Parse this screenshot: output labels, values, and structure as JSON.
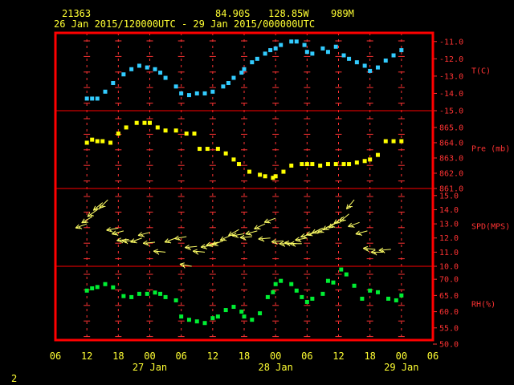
{
  "header": {
    "station_id": "21363",
    "lat": "84.90S",
    "lon": "128.85W",
    "elev": "989M",
    "period": "26 Jan 2015/120000UTC - 29 Jan 2015/000000UTC"
  },
  "footer": {
    "page": "2"
  },
  "colors": {
    "frame": "#ff0000",
    "grid": "#ff3333",
    "text": "#ffff33",
    "temp": "#33ccff",
    "pres": "#ffff00",
    "wind": "#ffff66",
    "rh": "#00ee33"
  },
  "x_axis": {
    "ticks": [
      {
        "h": 0,
        "label": "06"
      },
      {
        "h": 6,
        "label": "12"
      },
      {
        "h": 12,
        "label": "18"
      },
      {
        "h": 18,
        "label": "00"
      },
      {
        "h": 24,
        "label": "06"
      },
      {
        "h": 30,
        "label": "12"
      },
      {
        "h": 36,
        "label": "18"
      },
      {
        "h": 42,
        "label": "00"
      },
      {
        "h": 48,
        "label": "06"
      },
      {
        "h": 54,
        "label": "12"
      },
      {
        "h": 60,
        "label": "18"
      },
      {
        "h": 66,
        "label": "00"
      },
      {
        "h": 72,
        "label": "06"
      }
    ],
    "dates": [
      {
        "h": 18,
        "label": "27 Jan"
      },
      {
        "h": 42,
        "label": "28 Jan"
      },
      {
        "h": 66,
        "label": "29 Jan"
      }
    ],
    "range": [
      0,
      72
    ],
    "origin": "26 Jan 2015 06UTC"
  },
  "chart_data": [
    {
      "type": "scatter",
      "name_label": "T(C)",
      "ylim": [
        -15,
        -10.5
      ],
      "yticks": [
        "-11.0",
        "-12.0",
        "-13.0",
        "-14.0",
        "-15.0"
      ],
      "ytick_values": [
        -11,
        -12,
        -13,
        -14,
        -15
      ],
      "x": [
        6,
        7,
        8,
        9.5,
        11,
        13,
        14.5,
        16,
        17.5,
        19,
        20,
        21,
        23,
        24,
        25.5,
        27,
        28.5,
        30,
        32,
        33,
        34,
        35.5,
        36,
        37.5,
        38.5,
        40,
        41,
        42,
        43,
        45,
        46,
        47.5,
        48,
        49,
        51,
        52,
        53.5,
        55,
        56,
        57.5,
        59,
        60,
        61.5,
        63,
        64.5,
        66
      ],
      "y": [
        -14.3,
        -14.3,
        -14.3,
        -13.9,
        -13.4,
        -12.9,
        -12.6,
        -12.4,
        -12.5,
        -12.6,
        -12.8,
        -13.1,
        -13.6,
        -14.0,
        -14.1,
        -14.0,
        -14.0,
        -13.9,
        -13.6,
        -13.4,
        -13.1,
        -12.8,
        -12.6,
        -12.2,
        -12.0,
        -11.7,
        -11.5,
        -11.4,
        -11.2,
        -11.0,
        -11.0,
        -11.2,
        -11.6,
        -11.7,
        -11.4,
        -11.6,
        -11.3,
        -11.8,
        -12.0,
        -12.2,
        -12.4,
        -12.7,
        -12.5,
        -12.1,
        -11.8,
        -11.5
      ]
    },
    {
      "type": "scatter",
      "name_label": "Pre (mb)",
      "ylim": [
        861,
        866.1
      ],
      "yticks": [
        "865.0",
        "864.0",
        "863.0",
        "862.0",
        "861.0"
      ],
      "ytick_values": [
        865,
        864,
        863,
        862,
        861
      ],
      "x": [
        6,
        7,
        8,
        9,
        10.5,
        12,
        13.5,
        15.5,
        17,
        18,
        19.5,
        21,
        23,
        25,
        26.5,
        27.5,
        29,
        31,
        32.5,
        34,
        35,
        37,
        39,
        40,
        41.5,
        42,
        43.5,
        45,
        47,
        48,
        49,
        50.5,
        52,
        53.5,
        55,
        56,
        57.5,
        59,
        60,
        61.5,
        63,
        64.5,
        66
      ],
      "y": [
        864.0,
        864.2,
        864.1,
        864.1,
        864.0,
        864.6,
        865.0,
        865.3,
        865.3,
        865.3,
        865.0,
        864.8,
        864.8,
        864.6,
        864.6,
        863.6,
        863.6,
        863.6,
        863.3,
        862.9,
        862.6,
        862.1,
        861.9,
        861.8,
        861.7,
        861.8,
        862.1,
        862.5,
        862.6,
        862.6,
        862.6,
        862.5,
        862.6,
        862.6,
        862.6,
        862.6,
        862.7,
        862.8,
        862.9,
        863.2,
        864.1,
        864.1,
        864.1
      ]
    },
    {
      "type": "vector",
      "name_label": "SPD(MPS)",
      "ylim": [
        10,
        15.5
      ],
      "yticks": [
        "15.0",
        "14.0",
        "13.0",
        "12.0",
        "11.0",
        "10.0"
      ],
      "ytick_values": [
        15,
        14,
        13,
        12,
        11,
        10
      ],
      "x": [
        6,
        7,
        8,
        9,
        10,
        12,
        13,
        14,
        15,
        16.5,
        18,
        19,
        21,
        23,
        25,
        26,
        27,
        28.5,
        30,
        31,
        32,
        33.5,
        35,
        36,
        37.5,
        38.5,
        40,
        41,
        42,
        43.5,
        45,
        46,
        47,
        48,
        49,
        50,
        51,
        52,
        53,
        54,
        55,
        56,
        57,
        58,
        59.5,
        61,
        62.5,
        64
      ],
      "y": [
        13.0,
        13.5,
        14.0,
        14.5,
        14.7,
        12.7,
        12.5,
        11.9,
        11.8,
        12.0,
        12.4,
        11.7,
        11.0,
        12.0,
        12.1,
        10.0,
        11.4,
        11.0,
        11.5,
        11.7,
        11.8,
        12.2,
        12.6,
        12.3,
        12.1,
        12.5,
        13.0,
        12.0,
        13.4,
        11.8,
        11.6,
        11.6,
        11.6,
        12.0,
        12.3,
        12.5,
        12.7,
        12.8,
        13.0,
        13.2,
        13.5,
        13.7,
        14.7,
        13.1,
        12.5,
        11.2,
        11.0,
        11.2
      ],
      "dir_deg": [
        200,
        210,
        215,
        220,
        225,
        190,
        195,
        185,
        180,
        200,
        195,
        185,
        175,
        200,
        190,
        170,
        185,
        175,
        190,
        195,
        200,
        205,
        210,
        190,
        185,
        195,
        205,
        185,
        200,
        185,
        180,
        175,
        180,
        190,
        195,
        200,
        205,
        210,
        210,
        215,
        215,
        220,
        230,
        200,
        195,
        175,
        180,
        185
      ]
    },
    {
      "type": "scatter",
      "name_label": "RH(%)",
      "ylim": [
        50,
        74
      ],
      "yticks": [
        "70.0",
        "65.0",
        "60.0",
        "55.0",
        "50.0"
      ],
      "ytick_values": [
        70,
        65,
        60,
        55,
        50
      ],
      "x": [
        6,
        7,
        8,
        9.5,
        11,
        13,
        14.5,
        16,
        17.5,
        19,
        20,
        21,
        23,
        24,
        25.5,
        27,
        28.5,
        30,
        31,
        32.5,
        34,
        35.5,
        36,
        37.5,
        39,
        40.5,
        41.5,
        42,
        43,
        45,
        46,
        47,
        48,
        49,
        51,
        52,
        53,
        54.5,
        55.5,
        57,
        58.5,
        60,
        61.5,
        63.5,
        65,
        66
      ],
      "y": [
        66.5,
        67.2,
        67.6,
        68.5,
        67.5,
        64.8,
        64.5,
        65.5,
        65.5,
        65.9,
        65.5,
        64.5,
        63.5,
        58.5,
        57.5,
        57.0,
        56.5,
        58.0,
        58.5,
        60.5,
        61.5,
        60.0,
        58.5,
        57.5,
        59.5,
        64.5,
        66.0,
        68.5,
        69.5,
        68.5,
        66.5,
        64.5,
        63.0,
        64.0,
        65.5,
        69.5,
        69.0,
        73.0,
        71.5,
        68.0,
        64.0,
        66.5,
        66.0,
        64.0,
        63.5,
        65.0
      ]
    }
  ]
}
